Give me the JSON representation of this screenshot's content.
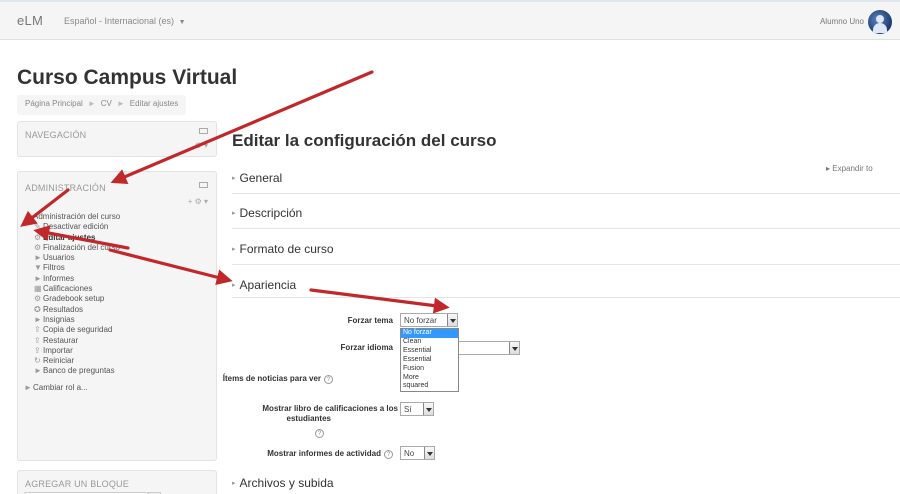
{
  "navbar": {
    "brand": "eLM",
    "language": "Español - Internacional (es)",
    "language_caret": "▼",
    "user_name": "Alumno Uno"
  },
  "page": {
    "title": "Curso Campus Virtual",
    "breadcrumb": [
      "Página Principal",
      "CV",
      "Editar ajustes"
    ],
    "breadcrumb_sep": "►"
  },
  "nav_block": {
    "title": "NAVEGACIÓN",
    "ctrl": "⚙ ▾"
  },
  "admin_block": {
    "title": "ADMINISTRACIÓN",
    "ctrl": "+ ⚙ ▾",
    "items": [
      {
        "icon": "▼",
        "label": "Administración del curso",
        "indent": 0,
        "bold": false,
        "icon_name": "caret-down-icon"
      },
      {
        "icon": "✎",
        "label": "Desactivar edición",
        "indent": 1,
        "bold": false,
        "icon_name": "pencil-icon"
      },
      {
        "icon": "⚙",
        "label": "Editar ajustes",
        "indent": 1,
        "bold": true,
        "icon_name": "gear-icon"
      },
      {
        "icon": "⚙",
        "label": "Finalización del curso",
        "indent": 1,
        "bold": false,
        "icon_name": "gear-icon"
      },
      {
        "icon": "►",
        "label": "Usuarios",
        "indent": 1,
        "bold": false,
        "icon_name": "caret-right-icon"
      },
      {
        "icon": "▼",
        "label": "Filtros",
        "indent": 1,
        "bold": false,
        "icon_name": "filter-icon"
      },
      {
        "icon": "►",
        "label": "Informes",
        "indent": 1,
        "bold": false,
        "icon_name": "caret-right-icon"
      },
      {
        "icon": "▦",
        "label": "Calificaciones",
        "indent": 1,
        "bold": false,
        "icon_name": "grades-icon"
      },
      {
        "icon": "⚙",
        "label": "Gradebook setup",
        "indent": 1,
        "bold": false,
        "icon_name": "gear-icon"
      },
      {
        "icon": "✪",
        "label": "Resultados",
        "indent": 1,
        "bold": false,
        "icon_name": "outcomes-icon"
      },
      {
        "icon": "►",
        "label": "Insignias",
        "indent": 1,
        "bold": false,
        "icon_name": "caret-right-icon"
      },
      {
        "icon": "⇪",
        "label": "Copia de seguridad",
        "indent": 1,
        "bold": false,
        "icon_name": "backup-icon"
      },
      {
        "icon": "⇪",
        "label": "Restaurar",
        "indent": 1,
        "bold": false,
        "icon_name": "restore-icon"
      },
      {
        "icon": "⇪",
        "label": "Importar",
        "indent": 1,
        "bold": false,
        "icon_name": "import-icon"
      },
      {
        "icon": "↻",
        "label": "Reiniciar",
        "indent": 1,
        "bold": false,
        "icon_name": "reset-icon"
      },
      {
        "icon": "►",
        "label": "Banco de preguntas",
        "indent": 1,
        "bold": false,
        "icon_name": "caret-right-icon"
      },
      {
        "icon": "",
        "label": "",
        "indent": 0,
        "bold": false,
        "icon_name": "spacer"
      },
      {
        "icon": "►",
        "label": "Cambiar rol a...",
        "indent": 0,
        "bold": false,
        "icon_name": "caret-right-icon"
      }
    ]
  },
  "add_block": {
    "title": "AGREGAR UN BLOQUE"
  },
  "main": {
    "title": "Editar la configuración del curso",
    "expand_all": "▸ Expandir to",
    "sections": {
      "general": "General",
      "description": "Descripción",
      "format": "Formato de curso",
      "appearance": "Apariencia",
      "files": "Archivos y subida"
    },
    "section_triangle": "▸"
  },
  "form": {
    "force_theme_label": "Forzar tema",
    "force_theme_value": "No forzar",
    "force_lang_label": "Forzar idioma",
    "news_label": "Ítems de noticias para ver",
    "gradebook_label_1": "Mostrar libro de calificaciones a los",
    "gradebook_label_2": "estudiantes",
    "gradebook_value": "Sí",
    "activity_label": "Mostrar informes de actividad",
    "activity_value": "No",
    "help_glyph": "?"
  },
  "theme_options": [
    "No forzar",
    "Clean",
    "Essential",
    "Essential",
    "Fusion",
    "More",
    "squared"
  ],
  "colors": {
    "arrow": "#c0282b",
    "select_highlight": "#3399ff"
  }
}
